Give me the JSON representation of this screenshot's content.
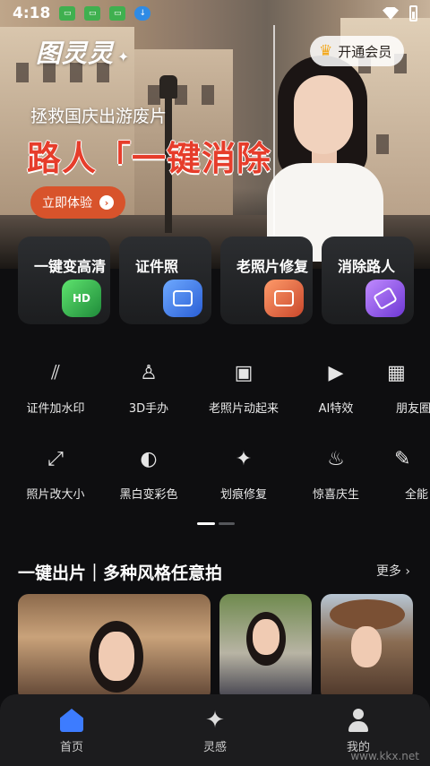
{
  "status_bar": {
    "time": "4:18"
  },
  "hero": {
    "logo": "图灵灵",
    "vip_label": "开通会员",
    "subtitle": "拯救国庆出游废片",
    "headline": "路人「一键消除",
    "cta_label": "立即体验"
  },
  "feature_cards": [
    {
      "label": "一键变高清",
      "icon": "hd-icon",
      "icon_text": "HD"
    },
    {
      "label": "证件照",
      "icon": "id-photo-icon",
      "icon_text": ""
    },
    {
      "label": "老照片修复",
      "icon": "old-photo-icon",
      "icon_text": ""
    },
    {
      "label": "消除路人",
      "icon": "eraser-icon",
      "icon_text": ""
    }
  ],
  "tools_row1": [
    {
      "label": "证件加水印",
      "icon": "watermark-icon",
      "glyph": "⫽"
    },
    {
      "label": "3D手办",
      "icon": "figure-icon",
      "glyph": "♙"
    },
    {
      "label": "老照片动起来",
      "icon": "animate-photo-icon",
      "glyph": "▣"
    },
    {
      "label": "AI特效",
      "icon": "film-icon",
      "glyph": "▶"
    },
    {
      "label": "朋友圈",
      "icon": "grid-icon",
      "glyph": "▦"
    }
  ],
  "tools_row2": [
    {
      "label": "照片改大小",
      "icon": "resize-icon",
      "glyph": "⤢"
    },
    {
      "label": "黑白变彩色",
      "icon": "palette-icon",
      "glyph": "◐"
    },
    {
      "label": "划痕修复",
      "icon": "repair-icon",
      "glyph": "✦"
    },
    {
      "label": "惊喜庆生",
      "icon": "cake-icon",
      "glyph": "♨"
    },
    {
      "label": "全能",
      "icon": "edit-icon",
      "glyph": "✎"
    }
  ],
  "section": {
    "title": "一键出片｜多种风格任意拍",
    "more_label": "更多 ›"
  },
  "nav": [
    {
      "label": "首页",
      "icon": "home-icon",
      "active": true
    },
    {
      "label": "灵感",
      "icon": "sparkle-icon",
      "active": false
    },
    {
      "label": "我的",
      "icon": "user-icon",
      "active": false
    }
  ],
  "watermark": "www.kkx.net",
  "colors": {
    "accent": "#3d7cff",
    "headline_red": "#e63d2b",
    "cta_orange": "#d8532b",
    "background": "#0e0e10"
  }
}
